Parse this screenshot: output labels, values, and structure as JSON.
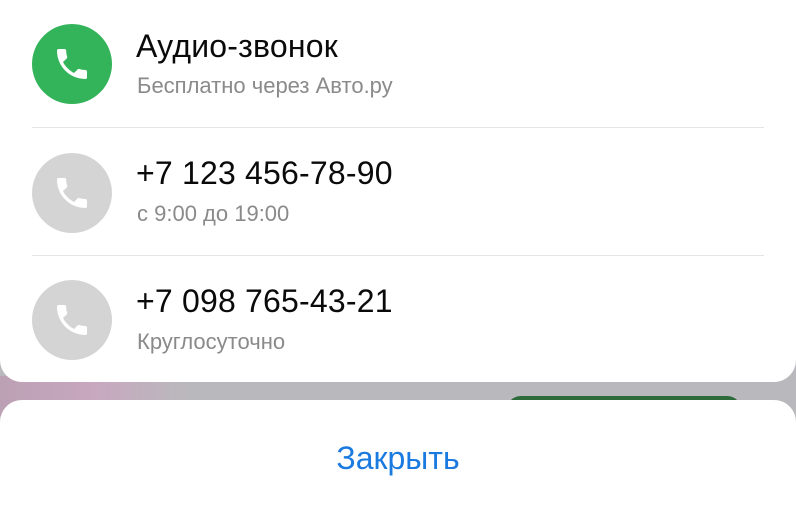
{
  "contacts": [
    {
      "title": "Аудио-звонок",
      "subtitle": "Бесплатно через Авто.ру",
      "icon": "phone-icon",
      "color": "#34b45a"
    },
    {
      "title": "+7 123 456-78-90",
      "subtitle": "с 9:00 до 19:00",
      "icon": "phone-icon",
      "color": "#d4d4d4"
    },
    {
      "title": "+7 098 765-43-21",
      "subtitle": "Круглосуточно",
      "icon": "phone-icon",
      "color": "#d4d4d4"
    }
  ],
  "close_label": "Закрыть",
  "colors": {
    "accent": "#1b7ae0",
    "green": "#34b45a",
    "gray_icon": "#d4d4d4"
  }
}
